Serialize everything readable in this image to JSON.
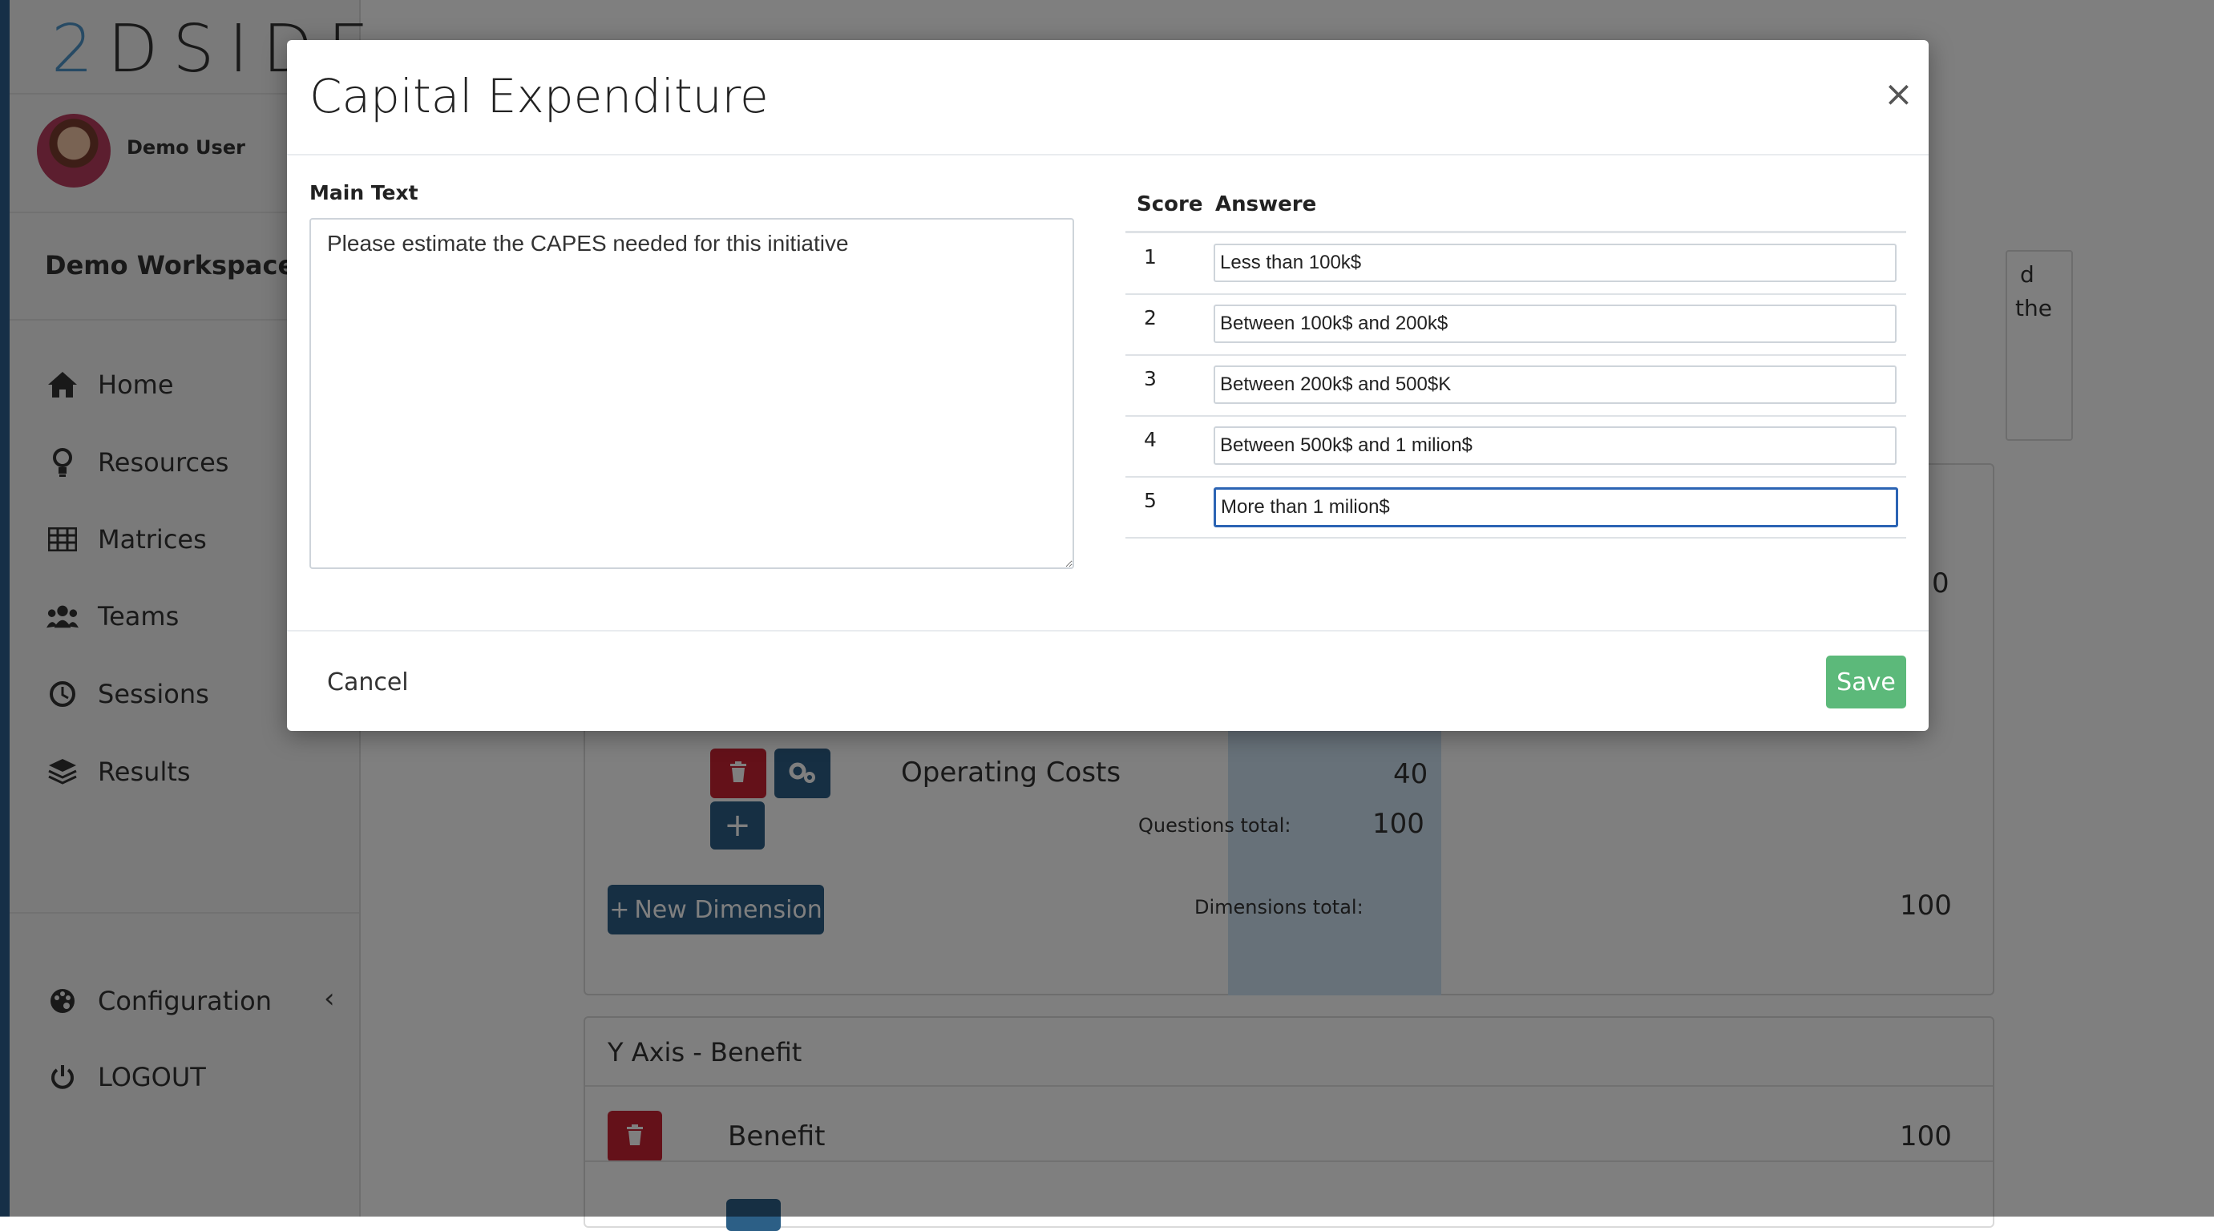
{
  "brand": {
    "logo_first": "2",
    "logo_rest": "DSIDE"
  },
  "sidebar": {
    "user_name": "Demo User",
    "workspace": "Demo Workspace",
    "items": [
      {
        "label": "Home",
        "icon": "home-icon"
      },
      {
        "label": "Resources",
        "icon": "lightbulb-icon"
      },
      {
        "label": "Matrices",
        "icon": "table-icon"
      },
      {
        "label": "Teams",
        "icon": "users-icon"
      },
      {
        "label": "Sessions",
        "icon": "clock-icon"
      },
      {
        "label": "Results",
        "icon": "layers-icon"
      }
    ],
    "configuration": "Configuration",
    "logout": "LOGOUT"
  },
  "background": {
    "partial_text_1": "d",
    "partial_text_2": "the",
    "partial_value": "0",
    "operating_costs": "Operating Costs",
    "operating_costs_value": "40",
    "questions_total_label": "Questions total:",
    "questions_total_value": "100",
    "new_dimension": "New Dimension",
    "dimensions_total_label": "Dimensions total:",
    "dimensions_total_value": "100",
    "y_axis_label": "Y Axis -",
    "y_axis_name": "Benefit",
    "benefit_row": "Benefit",
    "benefit_value": "100"
  },
  "modal": {
    "title": "Capital Expenditure",
    "main_text_label": "Main Text",
    "main_text_value": "Please estimate the CAPES needed for this initiative",
    "table": {
      "headers": {
        "score": "Score",
        "answer": "Answere"
      },
      "rows": [
        {
          "score": "1",
          "answer": "Less than 100k$"
        },
        {
          "score": "2",
          "answer": "Between 100k$ and 200k$"
        },
        {
          "score": "3",
          "answer": "Between 200k$ and 500$K"
        },
        {
          "score": "4",
          "answer": "Between 500k$ and 1 milion$"
        },
        {
          "score": "5",
          "answer": "More than 1 milion$"
        }
      ]
    },
    "cancel_label": "Cancel",
    "save_label": "Save"
  },
  "colors": {
    "primary": "#2c5f86",
    "danger": "#c82333",
    "success": "#5cb97a",
    "focus": "#2c64b4"
  }
}
